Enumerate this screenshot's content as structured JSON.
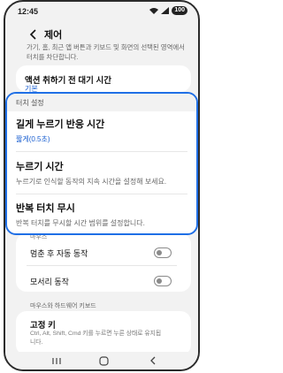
{
  "status": {
    "time": "12:45",
    "battery": "100"
  },
  "header": {
    "title": "제어"
  },
  "top": {
    "description": "가기, 홈, 최근 앱 버튼과 키보드 및 화면의 선택된 영역에서 터치를 차단합니다.",
    "wait_title": "액션 취하기 전 대기 시간",
    "wait_value": "기본"
  },
  "zoom": {
    "section_header": "터치 설정",
    "items": [
      {
        "title": "길게 누르기 반응 시간",
        "subtitle": "짧게(0.5초)"
      },
      {
        "title": "누르기 시간",
        "subtitle": "누르기로 인식할 동작의 지속 시간을 설정해 보세요."
      },
      {
        "title": "반복 터치 무시",
        "subtitle": "반복 터치를 무시할 시간 범위를 설정합니다."
      }
    ]
  },
  "cut_label": "마우스",
  "toggles": [
    {
      "label": "멈춘 후 자동 동작",
      "on": false
    },
    {
      "label": "모서리 동작",
      "on": false
    }
  ],
  "mouse_section": {
    "header": "마우스와 하드웨어 키보드",
    "sticky_title": "고정 키",
    "sticky_desc": "Ctrl, Alt, Shift, Cmd 키를 누르면 누른 상태로 유지됩니다."
  },
  "colors": {
    "accent": "#1f6fe6",
    "value_blue": "#1a5fd0"
  }
}
